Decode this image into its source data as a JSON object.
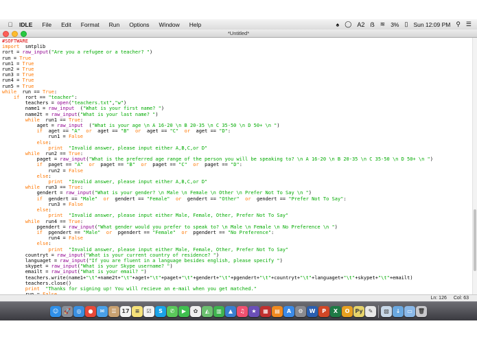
{
  "menubar": {
    "app_name": "IDLE",
    "items": [
      "File",
      "Edit",
      "Format",
      "Run",
      "Options",
      "Window",
      "Help"
    ],
    "battery": "3%",
    "clock": "Sun 12:09 PM",
    "adobe_badge": "A2"
  },
  "window": {
    "title": "*Untitled*"
  },
  "status": {
    "line": "Ln: 126",
    "col": "Col: 63"
  },
  "code_lines": [
    [
      [
        "cm",
        "#SOFTWARE"
      ]
    ],
    [
      [
        "kw",
        "import"
      ],
      [
        "",
        "  smtplib"
      ]
    ],
    [
      [
        "",
        "rort = "
      ],
      [
        "bi",
        "raw_input"
      ],
      [
        "",
        "("
      ],
      [
        "st",
        "\"Are you a refugee or a teacher? \""
      ],
      [
        "",
        ")"
      ]
    ],
    [
      [
        "",
        "run = "
      ],
      [
        "kw",
        "True"
      ]
    ],
    [
      [
        "",
        "run1 = "
      ],
      [
        "kw",
        "True"
      ]
    ],
    [
      [
        "",
        "run2 = "
      ],
      [
        "kw",
        "True"
      ]
    ],
    [
      [
        "",
        "run3 = "
      ],
      [
        "kw",
        "True"
      ]
    ],
    [
      [
        "",
        "run4 = "
      ],
      [
        "kw",
        "True"
      ]
    ],
    [
      [
        "",
        "run5 = "
      ],
      [
        "kw",
        "True"
      ]
    ],
    [
      [
        "kw",
        "while"
      ],
      [
        "",
        "  run == "
      ],
      [
        "kw",
        "True"
      ],
      [
        "",
        ":"
      ]
    ],
    [
      [
        "",
        "    "
      ],
      [
        "kw",
        "if"
      ],
      [
        "",
        "  rort == "
      ],
      [
        "st",
        "\"teacher\""
      ],
      [
        "",
        ":"
      ]
    ],
    [
      [
        "",
        "        teachers = "
      ],
      [
        "bi",
        "open"
      ],
      [
        "",
        "("
      ],
      [
        "st",
        "\"teachers.txt\""
      ],
      [
        "",
        ","
      ],
      [
        "st",
        "\"w\""
      ],
      [
        "",
        ")"
      ]
    ],
    [
      [
        "",
        "        name1 = "
      ],
      [
        "bi",
        "raw_input"
      ],
      [
        "",
        "  ("
      ],
      [
        "st",
        "\"What is your first name? \""
      ],
      [
        "",
        ")"
      ]
    ],
    [
      [
        "",
        "        name2t = "
      ],
      [
        "bi",
        "raw_input"
      ],
      [
        "",
        "("
      ],
      [
        "st",
        "\"What is your last name? \""
      ],
      [
        "",
        ")"
      ]
    ],
    [
      [
        "",
        "        "
      ],
      [
        "kw",
        "while"
      ],
      [
        "",
        "  run1 == "
      ],
      [
        "kw",
        "True"
      ],
      [
        "",
        ":"
      ]
    ],
    [
      [
        "",
        "            aget = "
      ],
      [
        "bi",
        "raw_input"
      ],
      [
        "",
        "  ("
      ],
      [
        "st",
        "\"What is your age \\n A 16-20 \\n B 20-35 \\n C 35-50 \\n D 50+ \\n \""
      ],
      [
        "",
        ")"
      ]
    ],
    [
      [
        "",
        "            "
      ],
      [
        "kw",
        "if"
      ],
      [
        "",
        "  aget == "
      ],
      [
        "st",
        "\"A\""
      ],
      [
        "",
        "  "
      ],
      [
        "kw",
        "or"
      ],
      [
        "",
        "  aget == "
      ],
      [
        "st",
        "\"B\""
      ],
      [
        "",
        "  "
      ],
      [
        "kw",
        "or"
      ],
      [
        "",
        "  aget == "
      ],
      [
        "st",
        "\"C\""
      ],
      [
        "",
        "  "
      ],
      [
        "kw",
        "or"
      ],
      [
        "",
        "  aget == "
      ],
      [
        "st",
        "\"D\""
      ],
      [
        "",
        ":"
      ]
    ],
    [
      [
        "",
        "                run1 = "
      ],
      [
        "kw",
        "False"
      ]
    ],
    [
      [
        "",
        "            "
      ],
      [
        "kw",
        "else"
      ],
      [
        "",
        ":"
      ]
    ],
    [
      [
        "",
        "                "
      ],
      [
        "kw",
        "print"
      ],
      [
        "",
        "  "
      ],
      [
        "st",
        "\"Invalid answer, please input either A,B,C,or D\""
      ]
    ],
    [
      [
        "",
        "        "
      ],
      [
        "kw",
        "while"
      ],
      [
        "",
        "  run2 == "
      ],
      [
        "kw",
        "True"
      ],
      [
        "",
        ":"
      ]
    ],
    [
      [
        "",
        "            paget = "
      ],
      [
        "bi",
        "raw_input"
      ],
      [
        "",
        "("
      ],
      [
        "st",
        "\"What is the preferred age range of the person you will be speaking to? \\n A 16-20 \\n B 20-35 \\n C 35-50 \\n D 50+ \\n \""
      ],
      [
        "",
        ")"
      ]
    ],
    [
      [
        "",
        "            "
      ],
      [
        "kw",
        "if"
      ],
      [
        "",
        "  paget == "
      ],
      [
        "st",
        "\"A\""
      ],
      [
        "",
        "  "
      ],
      [
        "kw",
        "or"
      ],
      [
        "",
        "  paget == "
      ],
      [
        "st",
        "\"B\""
      ],
      [
        "",
        "  "
      ],
      [
        "kw",
        "or"
      ],
      [
        "",
        "  paget == "
      ],
      [
        "st",
        "\"C\""
      ],
      [
        "",
        "  "
      ],
      [
        "kw",
        "or"
      ],
      [
        "",
        "  paget == "
      ],
      [
        "st",
        "\"D\""
      ],
      [
        "",
        ":"
      ]
    ],
    [
      [
        "",
        "                run2 = "
      ],
      [
        "kw",
        "False"
      ]
    ],
    [
      [
        "",
        "            "
      ],
      [
        "kw",
        "else"
      ],
      [
        "",
        ":"
      ]
    ],
    [
      [
        "",
        "                "
      ],
      [
        "kw",
        "print"
      ],
      [
        "",
        "  "
      ],
      [
        "st",
        "\"Invalid answer, please input either A,B,C,or D\""
      ]
    ],
    [
      [
        "",
        "        "
      ],
      [
        "kw",
        "while"
      ],
      [
        "",
        "  run3 == "
      ],
      [
        "kw",
        "True"
      ],
      [
        "",
        ":"
      ]
    ],
    [
      [
        "",
        "            gendert = "
      ],
      [
        "bi",
        "raw_input"
      ],
      [
        "",
        "("
      ],
      [
        "st",
        "\"What is your gender? \\n Male \\n Female \\n Other \\n Prefer Not To Say \\n \""
      ],
      [
        "",
        ")"
      ]
    ],
    [
      [
        "",
        "            "
      ],
      [
        "kw",
        "if"
      ],
      [
        "",
        "  gendert == "
      ],
      [
        "st",
        "\"Male\""
      ],
      [
        "",
        "  "
      ],
      [
        "kw",
        "or"
      ],
      [
        "",
        "  gendert == "
      ],
      [
        "st",
        "\"Female\""
      ],
      [
        "",
        "  "
      ],
      [
        "kw",
        "or"
      ],
      [
        "",
        "  gendert == "
      ],
      [
        "st",
        "\"Other\""
      ],
      [
        "",
        "  "
      ],
      [
        "kw",
        "or"
      ],
      [
        "",
        "  gendert == "
      ],
      [
        "st",
        "\"Prefer Not To Say\""
      ],
      [
        "",
        ":"
      ]
    ],
    [
      [
        "",
        "                run3 = "
      ],
      [
        "kw",
        "False"
      ]
    ],
    [
      [
        "",
        "            "
      ],
      [
        "kw",
        "else"
      ],
      [
        "",
        ":"
      ]
    ],
    [
      [
        "",
        "                "
      ],
      [
        "kw",
        "print"
      ],
      [
        "",
        "  "
      ],
      [
        "st",
        "\"Invalid answer, please input either Male, Female, Other, Prefer Not To Say\""
      ]
    ],
    [
      [
        "",
        "        "
      ],
      [
        "kw",
        "while"
      ],
      [
        "",
        "  run4 == "
      ],
      [
        "kw",
        "True"
      ],
      [
        "",
        ":"
      ]
    ],
    [
      [
        "",
        "            pgendert = "
      ],
      [
        "bi",
        "raw_input"
      ],
      [
        "",
        "("
      ],
      [
        "st",
        "\"What gender would you prefer to speak to? \\n Male \\n Female \\n No Preference \\n \""
      ],
      [
        "",
        ")"
      ]
    ],
    [
      [
        "",
        "            "
      ],
      [
        "kw",
        "if"
      ],
      [
        "",
        "  pgendert == "
      ],
      [
        "st",
        "\"Male\""
      ],
      [
        "",
        "  "
      ],
      [
        "kw",
        "or"
      ],
      [
        "",
        "  pgendert == "
      ],
      [
        "st",
        "\"Female\""
      ],
      [
        "",
        "  "
      ],
      [
        "kw",
        "or"
      ],
      [
        "",
        "  pgendert == "
      ],
      [
        "st",
        "\"No Preference\""
      ],
      [
        "",
        ":"
      ]
    ],
    [
      [
        "",
        "                run4 = "
      ],
      [
        "kw",
        "False"
      ]
    ],
    [
      [
        "",
        "            "
      ],
      [
        "kw",
        "else"
      ],
      [
        "",
        ":"
      ]
    ],
    [
      [
        "",
        "                "
      ],
      [
        "kw",
        "print"
      ],
      [
        "",
        "  "
      ],
      [
        "st",
        "\"Invalid answer, please input either Male, Female, Other, Prefer Not To Say\""
      ]
    ],
    [
      [
        "",
        "        countryt = "
      ],
      [
        "bi",
        "raw_input"
      ],
      [
        "",
        "("
      ],
      [
        "st",
        "\"What is your current country of residence? \""
      ],
      [
        "",
        ")"
      ]
    ],
    [
      [
        "",
        "        languaget = "
      ],
      [
        "bi",
        "raw_input"
      ],
      [
        "",
        "("
      ],
      [
        "st",
        "\"If you are fluent in a language besides english, please specify \""
      ],
      [
        "",
        ")"
      ]
    ],
    [
      [
        "",
        "        skypet = "
      ],
      [
        "bi",
        "raw_input"
      ],
      [
        "",
        "("
      ],
      [
        "st",
        "\"What is your Skype username? \""
      ],
      [
        "",
        ")"
      ]
    ],
    [
      [
        "",
        "        emailt = "
      ],
      [
        "bi",
        "raw_input"
      ],
      [
        "",
        "("
      ],
      [
        "st",
        "\"What is your email? \""
      ],
      [
        "",
        ")"
      ]
    ],
    [
      [
        "",
        "        teachers.write(name1+"
      ],
      [
        "st",
        "\"\\t\""
      ],
      [
        "",
        "+name2t+"
      ],
      [
        "st",
        "\"\\t\""
      ],
      [
        "",
        "+aget+"
      ],
      [
        "st",
        "\"\\t\""
      ],
      [
        "",
        "+paget+"
      ],
      [
        "st",
        "\"\\t\""
      ],
      [
        "",
        "+gendert+"
      ],
      [
        "st",
        "\"\\t\""
      ],
      [
        "",
        "+pgendert+"
      ],
      [
        "st",
        "\"\\t\""
      ],
      [
        "",
        "+countryt+"
      ],
      [
        "st",
        "\"\\t\""
      ],
      [
        "",
        "+languaget+"
      ],
      [
        "st",
        "\"\\t\""
      ],
      [
        "",
        "+skypet+"
      ],
      [
        "st",
        "\"\\t\""
      ],
      [
        "",
        "+emailt)"
      ]
    ],
    [
      [
        "",
        "        teachers.close()"
      ]
    ],
    [
      [
        "",
        "        "
      ],
      [
        "kw",
        "print"
      ],
      [
        "",
        "  "
      ],
      [
        "st",
        "\"Thanks for signing up! You will recieve an e-mail when you get matched.\""
      ]
    ],
    [
      [
        "",
        "        run = "
      ],
      [
        "kw",
        "False"
      ]
    ]
  ],
  "dock": [
    {
      "name": "finder-icon",
      "color": "#2f8fe8",
      "glyph": "☺"
    },
    {
      "name": "launchpad-icon",
      "color": "#8a8f98",
      "glyph": "🚀"
    },
    {
      "name": "safari-icon",
      "color": "#3a8fe0",
      "glyph": "◎"
    },
    {
      "name": "chrome-icon",
      "color": "#e84a3a",
      "glyph": "●"
    },
    {
      "name": "mail-icon",
      "color": "#4aa0e8",
      "glyph": "✉"
    },
    {
      "name": "contacts-icon",
      "color": "#c8a070",
      "glyph": "☰"
    },
    {
      "name": "calendar-icon",
      "color": "#f4f4f4",
      "glyph": "17"
    },
    {
      "name": "notes-icon",
      "color": "#f6e27a",
      "glyph": "≡"
    },
    {
      "name": "reminders-icon",
      "color": "#f2f2f2",
      "glyph": "☑"
    },
    {
      "name": "skype-icon",
      "color": "#1aa3e8",
      "glyph": "S"
    },
    {
      "name": "messages-icon",
      "color": "#5ac85a",
      "glyph": "✆"
    },
    {
      "name": "facetime-icon",
      "color": "#3fbf4f",
      "glyph": "▶"
    },
    {
      "name": "photos-icon",
      "color": "#f0f0f0",
      "glyph": "✿"
    },
    {
      "name": "maps-icon",
      "color": "#6cc070",
      "glyph": "◭"
    },
    {
      "name": "numbers-icon",
      "color": "#3fb34f",
      "glyph": "▥"
    },
    {
      "name": "keynote-icon",
      "color": "#3a7fd0",
      "glyph": "▲"
    },
    {
      "name": "itunes-icon",
      "color": "#f05070",
      "glyph": "♫"
    },
    {
      "name": "imovie-icon",
      "color": "#6a4fb8",
      "glyph": "★"
    },
    {
      "name": "photo-booth-icon",
      "color": "#c03030",
      "glyph": "▦"
    },
    {
      "name": "ibooks-icon",
      "color": "#f08a20",
      "glyph": "▤"
    },
    {
      "name": "app-store-icon",
      "color": "#3a8ae8",
      "glyph": "A"
    },
    {
      "name": "system-preferences-icon",
      "color": "#8a8a90",
      "glyph": "⚙"
    },
    {
      "name": "word-icon",
      "color": "#2b5fb0",
      "glyph": "W"
    },
    {
      "name": "powerpoint-icon",
      "color": "#d24726",
      "glyph": "P"
    },
    {
      "name": "excel-icon",
      "color": "#1e7a45",
      "glyph": "X"
    },
    {
      "name": "office-icon",
      "color": "#e8a020",
      "glyph": "O"
    },
    {
      "name": "python-launcher-icon",
      "color": "#e6d36a",
      "glyph": "Py"
    },
    {
      "name": "idle-icon",
      "color": "#e8e8e8",
      "glyph": "✎"
    },
    {
      "name": "preview-icon",
      "color": "#c8d8e8",
      "glyph": "▧"
    },
    {
      "name": "downloads-folder-icon",
      "color": "#6aa8e0",
      "glyph": "↓"
    },
    {
      "name": "documents-folder-icon",
      "color": "#8ab8e8",
      "glyph": "▭"
    },
    {
      "name": "trash-icon",
      "color": "#c8c8cc",
      "glyph": "🗑"
    }
  ]
}
